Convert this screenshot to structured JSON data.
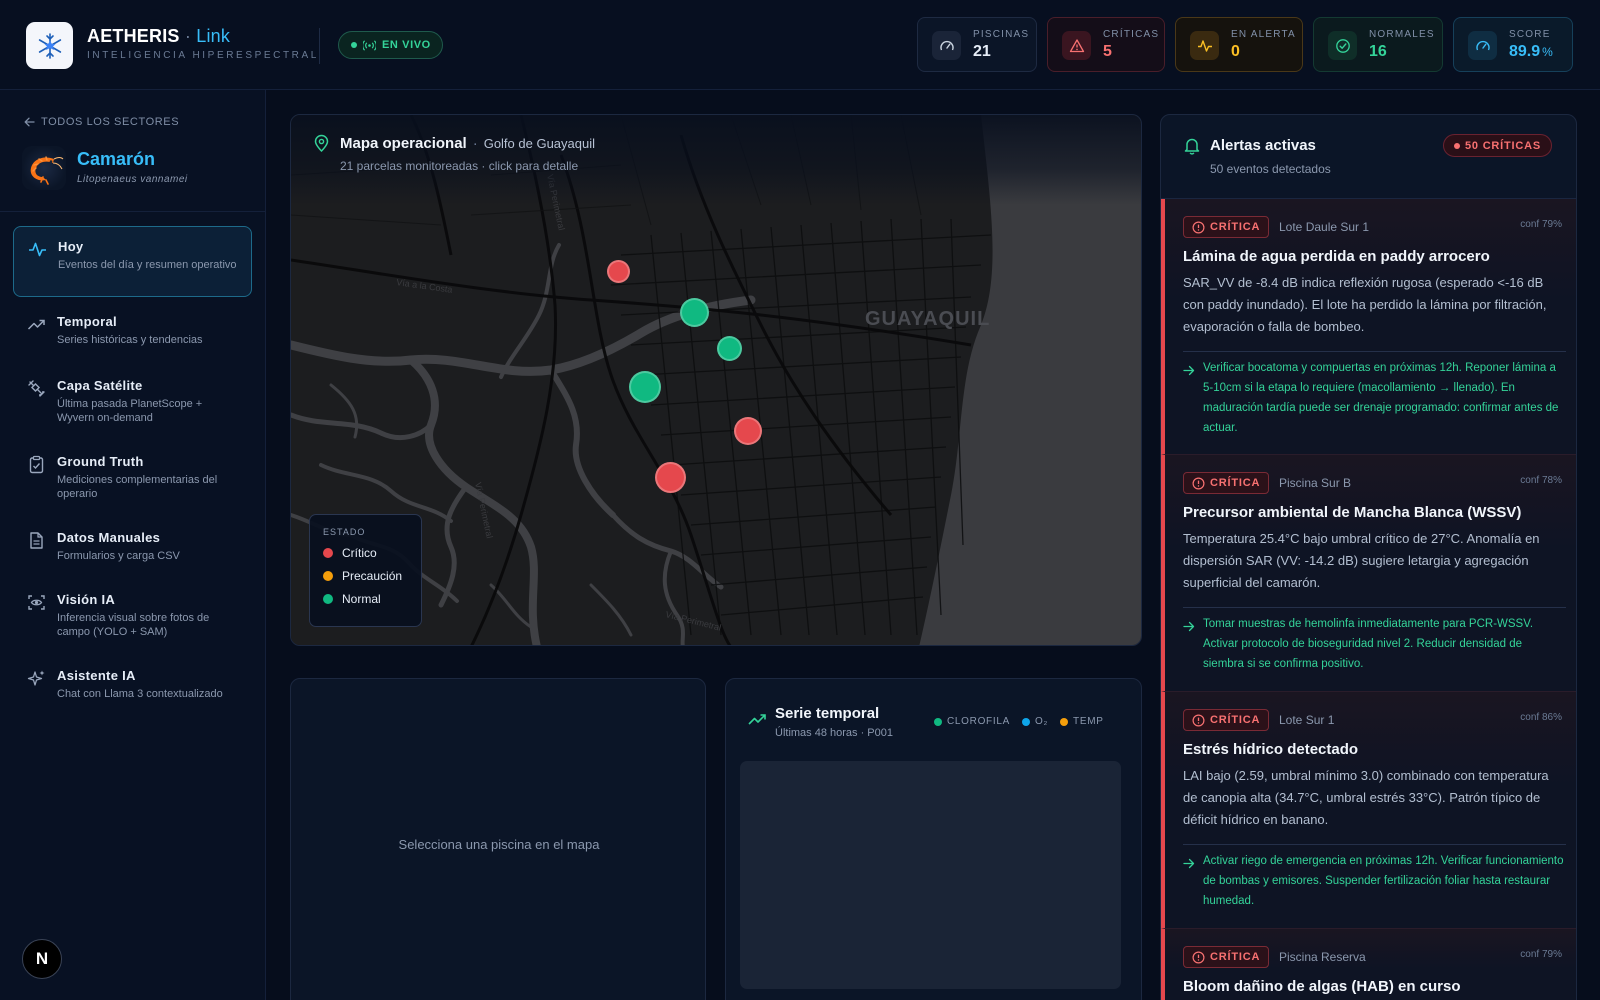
{
  "header": {
    "brand": "AETHERIS",
    "brand_dot": "·",
    "brand_link": "Link",
    "tagline": "INTELIGENCIA HIPERESPECTRAL",
    "live_label": "EN VIVO",
    "stats": [
      {
        "label": "PISCINAS",
        "value": "21",
        "color": "#e6edf7",
        "icon": "gauge-icon"
      },
      {
        "label": "CRÍTICAS",
        "value": "5",
        "color": "#f87171",
        "icon": "warning-icon"
      },
      {
        "label": "EN ALERTA",
        "value": "0",
        "color": "#fbbf24",
        "icon": "pulse-icon"
      },
      {
        "label": "NORMALES",
        "value": "16",
        "color": "#34d399",
        "icon": "check-circle-icon"
      },
      {
        "label": "SCORE",
        "value": "89.9",
        "unit": "%",
        "color": "#38bdf8",
        "icon": "gauge-icon"
      }
    ]
  },
  "sidebar": {
    "back_label": "TODOS LOS SECTORES",
    "sector_name": "Camarón",
    "sector_latin": "Litopenaeus vannamei",
    "items": [
      {
        "title": "Hoy",
        "desc": "Eventos del día y resumen operativo",
        "icon": "pulse-icon"
      },
      {
        "title": "Temporal",
        "desc": "Series históricas y tendencias",
        "icon": "trend-icon"
      },
      {
        "title": "Capa Satélite",
        "desc": "Última pasada PlanetScope + Wyvern on-demand",
        "icon": "satellite-icon"
      },
      {
        "title": "Ground Truth",
        "desc": "Mediciones complementarias del operario",
        "icon": "clipboard-icon"
      },
      {
        "title": "Datos Manuales",
        "desc": "Formularios y carga CSV",
        "icon": "file-icon"
      },
      {
        "title": "Visión IA",
        "desc": "Inferencia visual sobre fotos de campo (YOLO + SAM)",
        "icon": "scan-eye-icon"
      },
      {
        "title": "Asistente IA",
        "desc": "Chat con Llama 3 contextualizado",
        "icon": "sparkles-icon"
      }
    ],
    "badge": "N"
  },
  "map": {
    "title": "Mapa operacional",
    "separator": "·",
    "region": "Golfo de Guayaquil",
    "subtitle": "21 parcelas monitoreadas · click para detalle",
    "city_label": "GUAYAQUIL",
    "road_labels": [
      "Vía a la Costa",
      "Vía Perimetral",
      "Vía Perimetral",
      "Vía Perimetral"
    ],
    "legend_title": "ESTADO",
    "legend": [
      {
        "label": "Crítico",
        "color": "#e5484d"
      },
      {
        "label": "Precaución",
        "color": "#f59e0b"
      },
      {
        "label": "Normal",
        "color": "#10b981"
      }
    ],
    "colors": {
      "critical": "#e5484d",
      "normal": "#10b981"
    }
  },
  "detail": {
    "empty_text": "Selecciona una piscina en el mapa"
  },
  "series": {
    "title": "Serie temporal",
    "subtitle": "Últimas 48 horas · P001",
    "legend": [
      {
        "label": "CLOROFILA",
        "color": "#10b981"
      },
      {
        "label": "O₂",
        "color": "#0ea5e9"
      },
      {
        "label": "TEMP",
        "color": "#f59e0b"
      }
    ]
  },
  "alerts": {
    "title": "Alertas activas",
    "subtitle": "50 eventos detectados",
    "critical_pill": "50 CRÍTICAS",
    "items": [
      {
        "severity": "CRÍTICA",
        "location": "Lote Daule Sur 1",
        "confidence": "conf 79%",
        "title": "Lámina de agua perdida en paddy arrocero",
        "body": "SAR_VV de -8.4 dB indica reflexión rugosa (esperado <-16 dB con paddy inundado). El lote ha perdido la lámina por filtración, evaporación o falla de bombeo.",
        "action": "Verificar bocatoma y compuertas en próximas 12h. Reponer lámina a 5-10cm si la etapa lo requiere (macollamiento → llenado). En maduración tardía puede ser drenaje programado: confirmar antes de actuar."
      },
      {
        "severity": "CRÍTICA",
        "location": "Piscina Sur B",
        "confidence": "conf 78%",
        "title": "Precursor ambiental de Mancha Blanca (WSSV)",
        "body": "Temperatura 25.4°C bajo umbral crítico de 27°C. Anomalía en dispersión SAR (VV: -14.2 dB) sugiere letargia y agregación superficial del camarón.",
        "action": "Tomar muestras de hemolinfa inmediatamente para PCR-WSSV. Activar protocolo de bioseguridad nivel 2. Reducir densidad de siembra si se confirma positivo."
      },
      {
        "severity": "CRÍTICA",
        "location": "Lote Sur 1",
        "confidence": "conf 86%",
        "title": "Estrés hídrico detectado",
        "body": "LAI bajo (2.59, umbral mínimo 3.0) combinado con temperatura de canopia alta (34.7°C, umbral estrés 33°C). Patrón típico de déficit hídrico en banano.",
        "action": "Activar riego de emergencia en próximas 12h. Verificar funcionamiento de bombas y emisores. Suspender fertilización foliar hasta restaurar humedad."
      },
      {
        "severity": "CRÍTICA",
        "location": "Piscina Reserva",
        "confidence": "conf 79%",
        "title": "Bloom dañino de algas (HAB) en curso",
        "body": "",
        "action": ""
      }
    ]
  }
}
